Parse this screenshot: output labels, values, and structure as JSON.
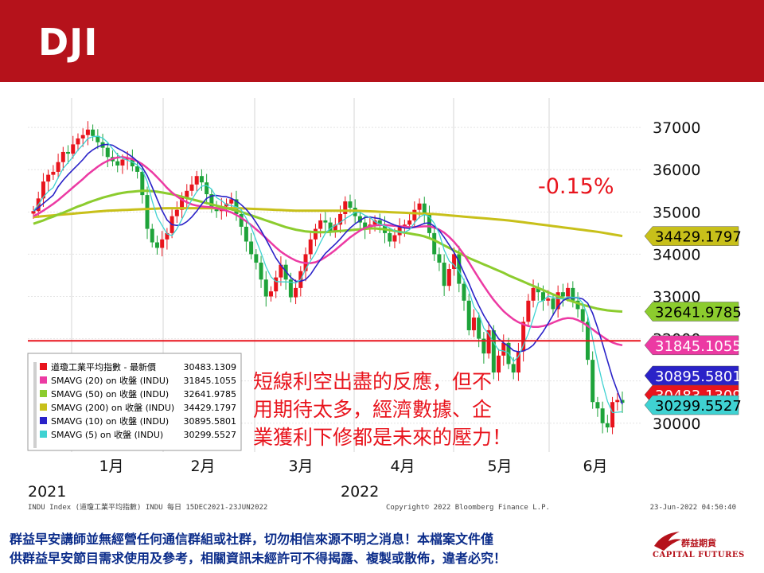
{
  "header": {
    "title": "DJI"
  },
  "chart_data": {
    "type": "line",
    "ylim": [
      29600,
      37700
    ],
    "yticks": [
      37000,
      36000,
      35000,
      34000,
      33000,
      32000,
      31000,
      30000
    ],
    "month_labels": [
      "1月",
      "2月",
      "3月",
      "4月",
      "5月",
      "6月"
    ],
    "year_labels": [
      "2021",
      "2022"
    ],
    "annotation": "-0.15%",
    "annotation_color": "#e8141d",
    "horizontal_line": {
      "value": 31950,
      "color": "#e8141d"
    },
    "note_lines": [
      "短線利空出盡的反應，但不",
      "用期待太多，經濟數據、企",
      "業獲利下修都是未來的壓力！"
    ],
    "footer_source": "INDU Index (道瓊工業平均指數) INDU  每日 15DEC2021-23JUN2022",
    "footer_copyright": "Copyright© 2022 Bloomberg Finance L.P.",
    "footer_time": "23-Jun-2022 04:50:40",
    "legend": [
      {
        "name": "道瓊工業平均指數 - 最新價",
        "value": "30483.1309",
        "color": "#e8141d"
      },
      {
        "name": "SMAVG (20)  on 收盤 (INDU)",
        "value": "31845.1055",
        "color": "#ec3aa3"
      },
      {
        "name": "SMAVG (50)  on 收盤 (INDU)",
        "value": "32641.9785",
        "color": "#8ccc2e"
      },
      {
        "name": "SMAVG (200)  on 收盤 (INDU)",
        "value": "34429.1797",
        "color": "#c8c01a"
      },
      {
        "name": "SMAVG (10)  on 收盤 (INDU)",
        "value": "30895.5801",
        "color": "#2a22c8"
      },
      {
        "name": "SMAVG (5)  on 收盤 (INDU)",
        "value": "30299.5527",
        "color": "#3fd2d2"
      }
    ],
    "value_tags": [
      {
        "label": "34429.1797",
        "color": "#c8c01a",
        "text_color": "#000000",
        "value": 34429
      },
      {
        "label": "32641.9785",
        "color": "#8ccc2e",
        "text_color": "#000000",
        "value": 32642
      },
      {
        "label": "31845.1055",
        "color": "#ec3aa3",
        "text_color": "#ffffff",
        "value": 31845
      },
      {
        "label": "30895.5801",
        "color": "#2a22c8",
        "text_color": "#ffffff",
        "value": 30896
      },
      {
        "label": "30483.1309",
        "color": "#e8141d",
        "text_color": "#ffffff",
        "value": 30483
      },
      {
        "label": "30299.5527",
        "color": "#3fd2d2",
        "text_color": "#000000",
        "value": 30300
      }
    ],
    "closes": [
      35020,
      35320,
      35720,
      35880,
      35950,
      36180,
      36420,
      36380,
      36600,
      36740,
      36820,
      36950,
      36800,
      36650,
      36520,
      36300,
      36200,
      36100,
      36240,
      36280,
      36080,
      35950,
      35400,
      34600,
      34280,
      34150,
      34350,
      34500,
      34900,
      35050,
      35350,
      35500,
      35650,
      35850,
      35700,
      35420,
      35100,
      35020,
      35130,
      35200,
      35300,
      34950,
      34650,
      34300,
      34000,
      33800,
      33400,
      33000,
      33120,
      33450,
      33750,
      33400,
      32980,
      33200,
      33600,
      34000,
      34350,
      34600,
      34800,
      34750,
      34550,
      34700,
      34950,
      35250,
      35100,
      34900,
      34750,
      34600,
      34700,
      34800,
      34700,
      34500,
      34300,
      34450,
      34650,
      34700,
      34800,
      35050,
      35200,
      34950,
      34500,
      34000,
      33800,
      33250,
      33650,
      34000,
      33300,
      32900,
      32200,
      32500,
      32000,
      31650,
      32200,
      31200,
      31600,
      31900,
      31400,
      31200,
      31700,
      32400,
      32900,
      33200,
      33100,
      32900,
      32950,
      32700,
      33100,
      33000,
      33200,
      32900,
      32700,
      32400,
      31500,
      30500,
      30350,
      30000,
      29900,
      30500,
      30550,
      30483
    ],
    "sma5": [
      35020,
      35170,
      35353,
      35485,
      35578,
      35810,
      36030,
      36166,
      36306,
      36464,
      36592,
      36738,
      36782,
      36792,
      36748,
      36646,
      36494,
      36354,
      36272,
      36224,
      36180,
      36110,
      35990,
      35720,
      35260,
      34880,
      34680,
      34480,
      34440,
      34600,
      34830,
      35060,
      35290,
      35480,
      35610,
      35630,
      35540,
      35340,
      35270,
      35170,
      35150,
      35120,
      35050,
      34850,
      34640,
      34330,
      34030,
      33700,
      33464,
      33354,
      33344,
      33344,
      33340,
      33316,
      33396,
      33646,
      33840,
      34030,
      34280,
      34500,
      34610,
      34680,
      34750,
      34840,
      34910,
      34990,
      34990,
      34920,
      34870,
      34770,
      34712,
      34670,
      34620,
      34550,
      34520,
      34520,
      34580,
      34740,
      34880,
      34940,
      34890,
      34730,
      34490,
      34100,
      33840,
      33740,
      33600,
      33380,
      33130,
      32760,
      32580,
      32250,
      32110,
      31910,
      31730,
      31710,
      31660,
      31460,
      31580,
      31840,
      32120,
      32480,
      32860,
      32900,
      33010,
      32980,
      32950,
      32940,
      32990,
      32980,
      32980,
      32840,
      32540,
      32000,
      31450,
      30950,
      30520,
      30250,
      30260,
      30270
    ],
    "sma10": [
      35020,
      35100,
      35200,
      35300,
      35400,
      35600,
      35750,
      35880,
      36000,
      36120,
      36240,
      36380,
      36470,
      36540,
      36590,
      36600,
      36580,
      36510,
      36450,
      36380,
      36300,
      36200,
      36060,
      35860,
      35590,
      35300,
      35030,
      34810,
      34700,
      34680,
      34700,
      34770,
      34880,
      35020,
      35180,
      35320,
      35380,
      35390,
      35370,
      35360,
      35320,
      35260,
      35170,
      35060,
      34920,
      34750,
      34560,
      34350,
      34130,
      33910,
      33740,
      33600,
      33450,
      33360,
      33360,
      33400,
      33520,
      33700,
      33870,
      34020,
      34130,
      34240,
      34360,
      34500,
      34620,
      34720,
      34800,
      34870,
      34880,
      34860,
      34840,
      34790,
      34740,
      34690,
      34650,
      34620,
      34610,
      34640,
      34680,
      34730,
      34740,
      34660,
      34560,
      34400,
      34220,
      34040,
      33820,
      33560,
      33310,
      33030,
      32780,
      32550,
      32360,
      32180,
      32000,
      31900,
      31820,
      31720,
      31690,
      31710,
      31760,
      31850,
      32010,
      32170,
      32360,
      32560,
      32760,
      32900,
      32960,
      32970,
      32970,
      32940,
      32840,
      32600,
      32260,
      31880,
      31480,
      31080,
      30760,
      30450
    ],
    "sma20": [
      34900,
      34960,
      35030,
      35110,
      35190,
      35280,
      35380,
      35480,
      35580,
      35680,
      35780,
      35890,
      35980,
      36070,
      36150,
      36210,
      36260,
      36290,
      36300,
      36280,
      36250,
      36200,
      36130,
      36040,
      35940,
      35820,
      35700,
      35570,
      35460,
      35370,
      35290,
      35230,
      35180,
      35150,
      35130,
      35120,
      35110,
      35090,
      35060,
      35030,
      34990,
      34930,
      34860,
      34780,
      34690,
      34590,
      34490,
      34380,
      34270,
      34160,
      34060,
      33980,
      33910,
      33850,
      33810,
      33790,
      33790,
      33810,
      33860,
      33930,
      34010,
      34100,
      34200,
      34300,
      34400,
      34480,
      34560,
      34620,
      34660,
      34680,
      34690,
      34690,
      34680,
      34670,
      34660,
      34650,
      34640,
      34640,
      34650,
      34660,
      34660,
      34630,
      34580,
      34510,
      34410,
      34290,
      34150,
      33990,
      33810,
      33620,
      33430,
      33250,
      33080,
      32920,
      32780,
      32650,
      32550,
      32460,
      32390,
      32340,
      32300,
      32280,
      32280,
      32300,
      32330,
      32380,
      32430,
      32470,
      32490,
      32480,
      32440,
      32380,
      32300,
      32220,
      32130,
      32050,
      31970,
      31910,
      31870,
      31845
    ],
    "sma50": [
      34720,
      34760,
      34800,
      34850,
      34890,
      34940,
      34980,
      35030,
      35080,
      35130,
      35170,
      35220,
      35260,
      35300,
      35340,
      35370,
      35400,
      35430,
      35450,
      35470,
      35480,
      35490,
      35500,
      35500,
      35490,
      35480,
      35460,
      35440,
      35420,
      35390,
      35360,
      35330,
      35300,
      35270,
      35240,
      35210,
      35180,
      35150,
      35120,
      35090,
      35060,
      35030,
      35000,
      34960,
      34920,
      34880,
      34840,
      34800,
      34760,
      34720,
      34680,
      34640,
      34610,
      34580,
      34560,
      34540,
      34530,
      34520,
      34520,
      34520,
      34530,
      34540,
      34550,
      34560,
      34570,
      34580,
      34590,
      34600,
      34610,
      34610,
      34600,
      34590,
      34570,
      34550,
      34530,
      34510,
      34490,
      34470,
      34450,
      34420,
      34380,
      34330,
      34270,
      34210,
      34150,
      34090,
      34030,
      33970,
      33910,
      33860,
      33810,
      33760,
      33710,
      33660,
      33610,
      33560,
      33500,
      33450,
      33400,
      33350,
      33300,
      33250,
      33200,
      33150,
      33100,
      33050,
      33000,
      32960,
      32920,
      32880,
      32840,
      32800,
      32770,
      32740,
      32710,
      32690,
      32670,
      32660,
      32650,
      32642
    ],
    "sma200": [
      34880,
      34890,
      34900,
      34910,
      34920,
      34930,
      34940,
      34950,
      34960,
      34970,
      34980,
      34990,
      35000,
      35010,
      35020,
      35030,
      35035,
      35040,
      35045,
      35050,
      35055,
      35060,
      35065,
      35070,
      35075,
      35080,
      35085,
      35090,
      35090,
      35090,
      35090,
      35090,
      35090,
      35090,
      35090,
      35090,
      35090,
      35090,
      35090,
      35090,
      35090,
      35090,
      35085,
      35080,
      35075,
      35070,
      35065,
      35060,
      35055,
      35050,
      35045,
      35040,
      35035,
      35030,
      35030,
      35030,
      35030,
      35030,
      35030,
      35030,
      35030,
      35030,
      35030,
      35030,
      35030,
      35030,
      35025,
      35020,
      35015,
      35010,
      35005,
      35000,
      34995,
      34990,
      34985,
      34980,
      34975,
      34970,
      34965,
      34960,
      34955,
      34950,
      34940,
      34930,
      34920,
      34910,
      34900,
      34890,
      34880,
      34870,
      34860,
      34850,
      34840,
      34830,
      34820,
      34810,
      34800,
      34785,
      34770,
      34755,
      34740,
      34725,
      34710,
      34695,
      34680,
      34665,
      34650,
      34635,
      34620,
      34605,
      34590,
      34575,
      34560,
      34545,
      34530,
      34510,
      34490,
      34470,
      34450,
      34429
    ]
  },
  "footer": {
    "line1": "群益早安講師並無經營任何通信群組或社群，切勿相信來源不明之消息！本檔案文件僅",
    "line2": "供群益早安節目需求使用及參考，相關資訊未經許可不得揭露、複製或散佈，違者必究！"
  },
  "logo": {
    "cn": "群益期貨",
    "en": "CAPITAL FUTURES"
  }
}
